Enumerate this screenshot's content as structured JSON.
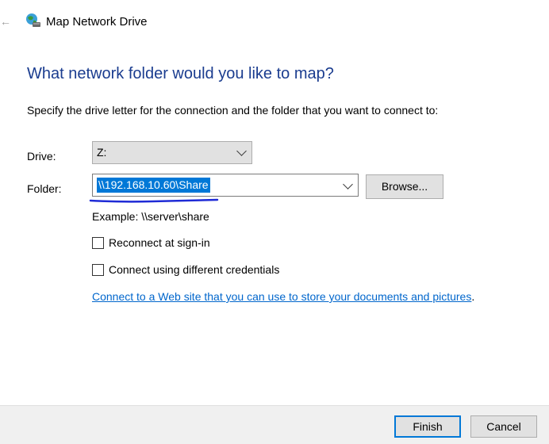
{
  "window": {
    "title": "Map Network Drive",
    "title_icon": "network-drive-globe-icon",
    "back_icon": "back-arrow-icon"
  },
  "main": {
    "heading": "What network folder would you like to map?",
    "instruction": "Specify the drive letter for the connection and the folder that you want to connect to:",
    "drive": {
      "label": "Drive:",
      "value": "Z:"
    },
    "folder": {
      "label": "Folder:",
      "value": "\\\\192.168.10.60\\Share",
      "browse_label": "Browse...",
      "example": "Example: \\\\server\\share"
    },
    "options": [
      {
        "label": "Reconnect at sign-in",
        "checked": false
      },
      {
        "label": "Connect using different credentials",
        "checked": false
      }
    ],
    "link": {
      "text": "Connect to a Web site that you can use to store your documents and pictures",
      "suffix": "."
    }
  },
  "footer": {
    "finish_label": "Finish",
    "cancel_label": "Cancel"
  },
  "colors": {
    "heading": "#1a3c8f",
    "link": "#0066cc",
    "selection": "#0078d7",
    "annotation": "#1f2bd6",
    "footer_bg": "#f0f0f0"
  }
}
